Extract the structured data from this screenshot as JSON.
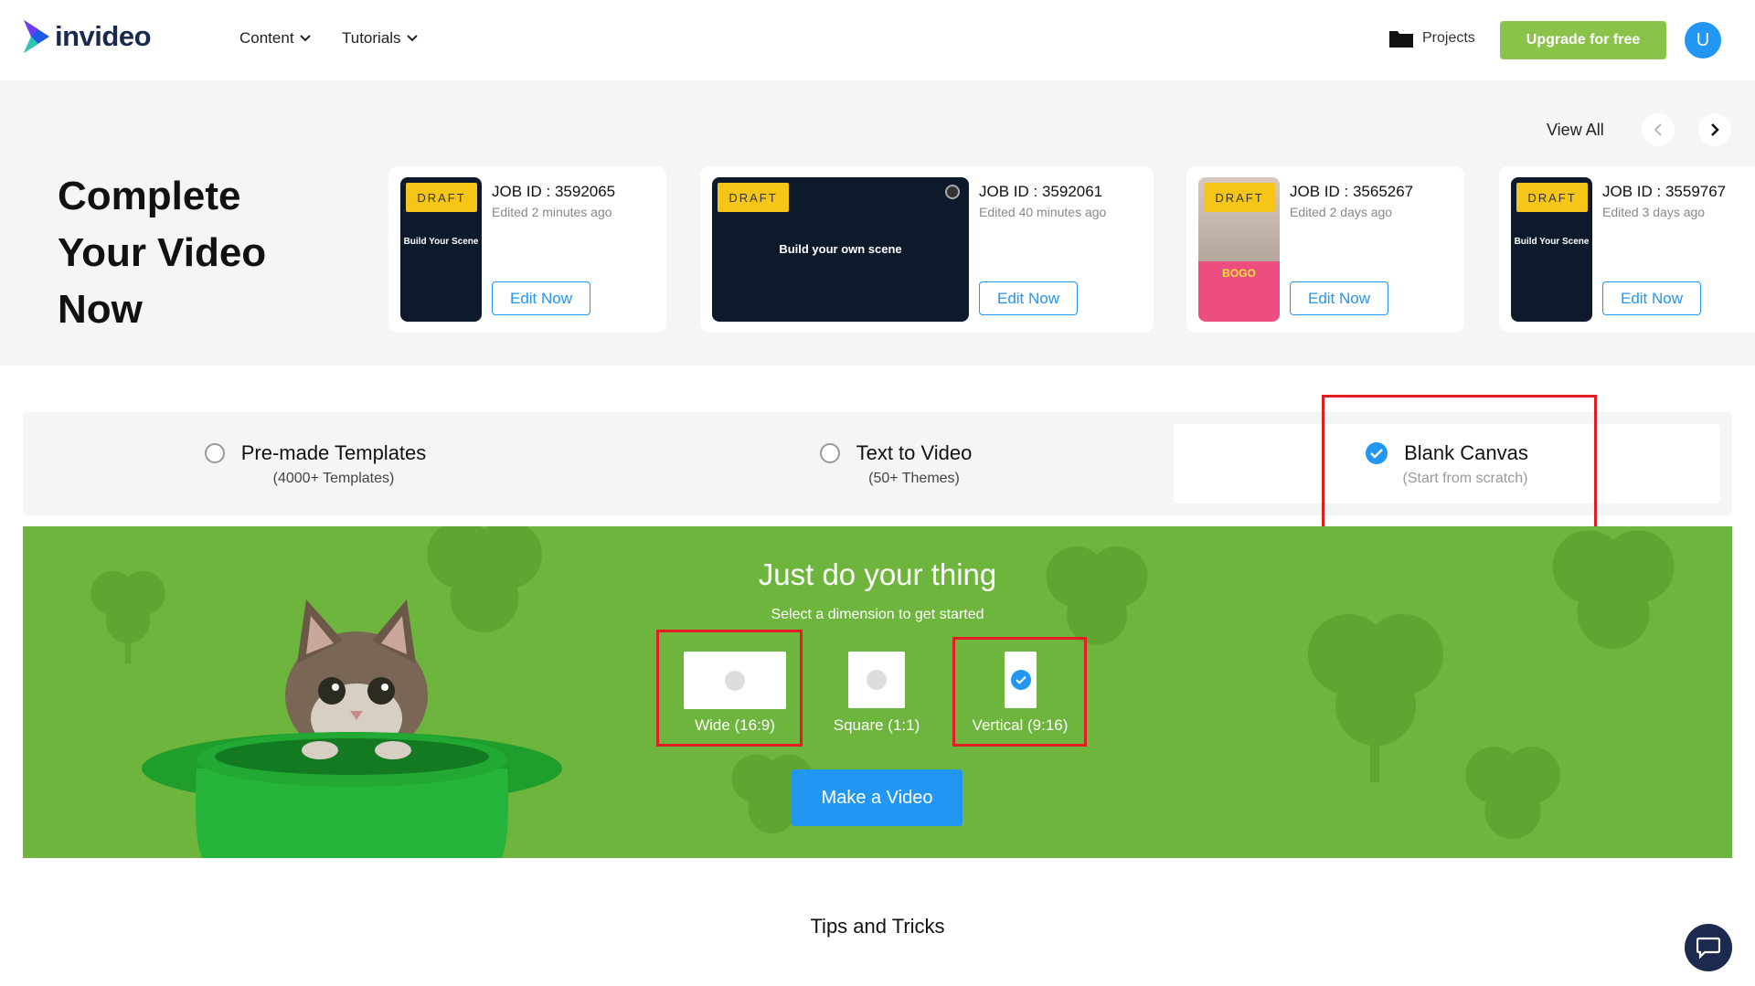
{
  "header": {
    "brand": "invideo",
    "nav": [
      {
        "label": "Content"
      },
      {
        "label": "Tutorials"
      }
    ],
    "projects_label": "Projects",
    "upgrade_label": "Upgrade for free",
    "avatar_initial": "U"
  },
  "drafts": {
    "title_lines": [
      "Complete",
      "Your Video",
      "Now"
    ],
    "view_all": "View All",
    "items": [
      {
        "badge": "DRAFT",
        "thumb_text": "Build Your Scene",
        "job_id": "JOB ID : 3592065",
        "edited": "Edited 2 minutes ago",
        "edit_label": "Edit Now"
      },
      {
        "badge": "DRAFT",
        "thumb_text": "Build your own scene",
        "job_id": "JOB ID : 3592061",
        "edited": "Edited 40 minutes ago",
        "edit_label": "Edit Now"
      },
      {
        "badge": "DRAFT",
        "thumb_text": "BOGO",
        "job_id": "JOB ID : 3565267",
        "edited": "Edited 2 days ago",
        "edit_label": "Edit Now"
      },
      {
        "badge": "DRAFT",
        "thumb_text": "Build Your Scene",
        "job_id": "JOB ID : 3559767",
        "edited": "Edited 3 days ago",
        "edit_label": "Edit Now"
      }
    ]
  },
  "modes": [
    {
      "label": "Pre-made Templates",
      "sub": "(4000+ Templates)",
      "selected": false
    },
    {
      "label": "Text to Video",
      "sub": "(50+ Themes)",
      "selected": false
    },
    {
      "label": "Blank Canvas",
      "sub": "(Start from scratch)",
      "selected": true
    }
  ],
  "hero": {
    "title": "Just do your thing",
    "subtitle": "Select a dimension to get started",
    "dimensions": [
      {
        "label": "Wide (16:9)",
        "selected": false
      },
      {
        "label": "Square (1:1)",
        "selected": false
      },
      {
        "label": "Vertical (9:16)",
        "selected": true
      }
    ],
    "cta": "Make a Video"
  },
  "tips_title": "Tips and Tricks",
  "colors": {
    "accent_blue": "#2196f3",
    "upgrade_green": "#8bc34a",
    "hero_green": "#6db53d",
    "draft_yellow": "#f5c518",
    "highlight_red": "#e01e24"
  }
}
